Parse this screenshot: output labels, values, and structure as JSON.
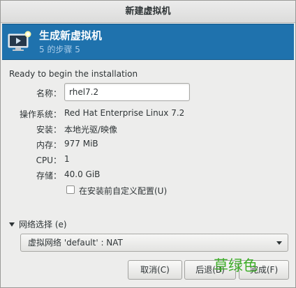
{
  "window": {
    "title": "新建虚拟机"
  },
  "banner": {
    "title": "生成新虚拟机",
    "step": "5 的步骤 5"
  },
  "summary": {
    "ready_text": "Ready to begin the installation",
    "name_label": "名称：",
    "name_value": "rhel7.2",
    "os_label": "操作系统：",
    "os_value": "Red Hat Enterprise Linux 7.2",
    "install_label": "安装：",
    "install_value": "本地光驱/映像",
    "memory_label": "内存：",
    "memory_value": "977 MiB",
    "cpu_label": "CPU：",
    "cpu_value": "1",
    "storage_label": "存储：",
    "storage_value": "40.0 GiB",
    "customize_label": "在安装前自定义配置(U)"
  },
  "network": {
    "expander_label": "网络选择 (e)",
    "selected": "虚拟网络 'default' : NAT"
  },
  "buttons": {
    "cancel": "取消(C)",
    "back": "后退(B)",
    "finish": "完成(F)"
  },
  "watermark": "草绿色"
}
